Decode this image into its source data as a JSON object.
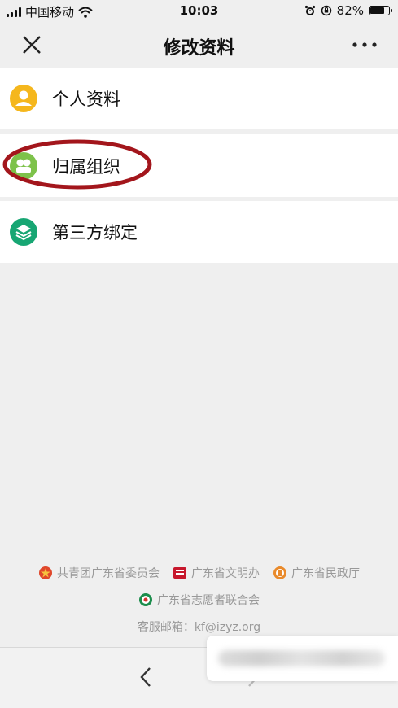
{
  "status_bar": {
    "carrier": "中国移动",
    "time": "10:03",
    "battery_percent": "82%",
    "battery_level": 0.82
  },
  "navbar": {
    "title": "修改资料",
    "close_icon": "close-icon",
    "more_icon": "more-icon"
  },
  "menu": {
    "items": [
      {
        "label": "个人资料",
        "icon": "person-icon",
        "color": "#F5B71D"
      },
      {
        "label": "归属组织",
        "icon": "group-icon",
        "color": "#7DC24A",
        "highlighted": true
      },
      {
        "label": "第三方绑定",
        "icon": "layers-icon",
        "color": "#17A673"
      }
    ]
  },
  "annotation": {
    "color": "#A3161C"
  },
  "footer": {
    "orgs": [
      "共青团广东省委员会",
      "广东省文明办",
      "广东省民政厅"
    ],
    "org4": "广东省志愿者联合会",
    "contact": "客服邮箱：kf@izyz.org"
  },
  "colors": {
    "background": "#EFEFEF",
    "row_bg": "#FFFFFF",
    "footer_text": "#999999"
  }
}
